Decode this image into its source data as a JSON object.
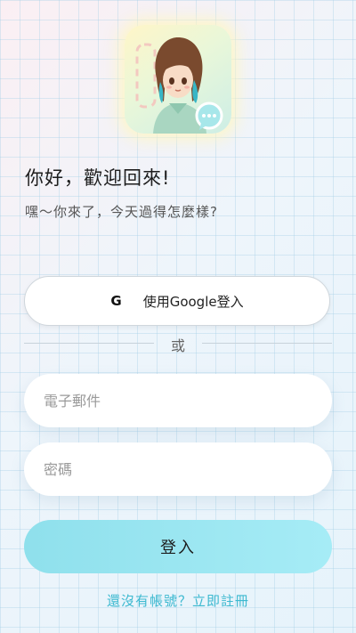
{
  "app": {
    "greeting": "你好，歡迎回來!",
    "subtitle": "嘿～你來了，今天過得怎麼樣?"
  },
  "google_login": {
    "icon_letter": "G",
    "label": "使用Google登入"
  },
  "divider": {
    "text": "或"
  },
  "email_field": {
    "placeholder": "電子郵件",
    "value": ""
  },
  "password_field": {
    "placeholder": "密碼",
    "value": ""
  },
  "login_button": {
    "label": "登入"
  },
  "register_link": {
    "label": "還沒有帳號？立即註冊"
  },
  "colors": {
    "accent": "#8fe0ec",
    "link": "#3cb9d0"
  }
}
